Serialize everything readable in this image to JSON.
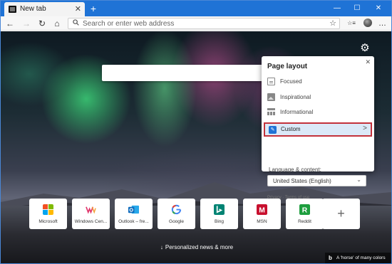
{
  "tab": {
    "title": "New tab",
    "close": "✕",
    "new_tab": "+"
  },
  "window_controls": {
    "minimize": "—",
    "maximize": "☐",
    "close": "✕"
  },
  "toolbar": {
    "back": "←",
    "forward": "→",
    "refresh": "↻",
    "home": "⌂",
    "address_placeholder": "Search or enter web address",
    "favorite_star": "☆",
    "favorites_icon": "☆≡",
    "more": "…"
  },
  "page": {
    "settings_icon": "⚙"
  },
  "layout_panel": {
    "close": "✕",
    "title": "Page layout",
    "options": [
      {
        "label": "Focused",
        "icon": "focused-layout-icon",
        "selected": false
      },
      {
        "label": "Inspirational",
        "icon": "inspirational-layout-icon",
        "selected": false
      },
      {
        "label": "Informational",
        "icon": "informational-layout-icon",
        "selected": false
      },
      {
        "label": "Custom",
        "icon": "pencil-icon",
        "selected": true
      }
    ],
    "custom_chevron": ">",
    "language_label": "Language & content:",
    "language_value": "United States (English)",
    "footer_privacy": "Privacy",
    "footer_sep": " · ",
    "footer_terms": "Terms of use"
  },
  "quick_links": [
    {
      "label": "Microsoft",
      "color": "#f25022"
    },
    {
      "label": "Windows Cen...",
      "color": "#e0356b"
    },
    {
      "label": "Outlook – fre...",
      "color": "#0f6cbd"
    },
    {
      "label": "Google",
      "color": "#4285f4"
    },
    {
      "label": "Bing",
      "color": "#008373"
    },
    {
      "label": "MSN",
      "color": "#c8102e"
    },
    {
      "label": "Reddit",
      "color": "#1e9e3e"
    }
  ],
  "quick_links_add": "+",
  "news": {
    "label": "Personalized news & more",
    "arrow": "↓"
  },
  "image_credit": {
    "logo": "b",
    "text": "A 'horse' of many colors"
  }
}
